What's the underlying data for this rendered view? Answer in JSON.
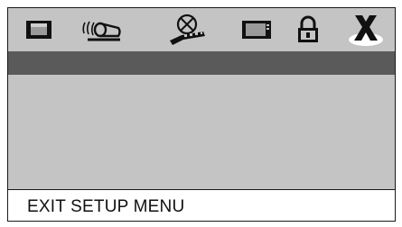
{
  "menu": {
    "items": [
      {
        "icon": "tv-screen-icon",
        "selected": false
      },
      {
        "icon": "speaker-sound-icon",
        "selected": false
      },
      {
        "icon": "film-reel-icon",
        "selected": false
      },
      {
        "icon": "monitor-icon",
        "selected": false
      },
      {
        "icon": "lock-icon",
        "selected": false
      },
      {
        "icon": "exit-x-icon",
        "selected": true
      }
    ]
  },
  "status": {
    "text": "EXIT SETUP MENU"
  },
  "colors": {
    "panel": "#c4c4c4",
    "highlight": "#5a5a5a",
    "selected_tab": "#ffffff",
    "border": "#1a1a1a",
    "icon": "#111111"
  }
}
